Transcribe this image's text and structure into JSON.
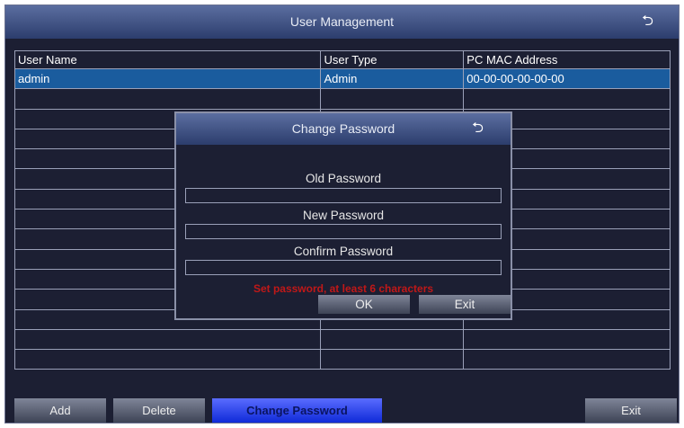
{
  "window": {
    "title": "User Management",
    "back_icon": "back-arrow-icon"
  },
  "table": {
    "headers": [
      "User Name",
      "User Type",
      "PC MAC Address"
    ],
    "rows": [
      [
        "admin",
        "Admin",
        "00-00-00-00-00-00"
      ]
    ]
  },
  "buttons": {
    "add": "Add",
    "delete": "Delete",
    "change_password": "Change Password",
    "exit": "Exit"
  },
  "dialog": {
    "title": "Change Password",
    "old_label": "Old Password",
    "new_label": "New Password",
    "confirm_label": "Confirm Password",
    "old_value": "",
    "new_value": "",
    "confirm_value": "",
    "warning": "Set password, at least 6 characters",
    "ok": "OK",
    "exit": "Exit"
  },
  "colors": {
    "selected_row": "#1a5c9e",
    "warning": "#c01818",
    "active_button": "#1f3cf0"
  }
}
